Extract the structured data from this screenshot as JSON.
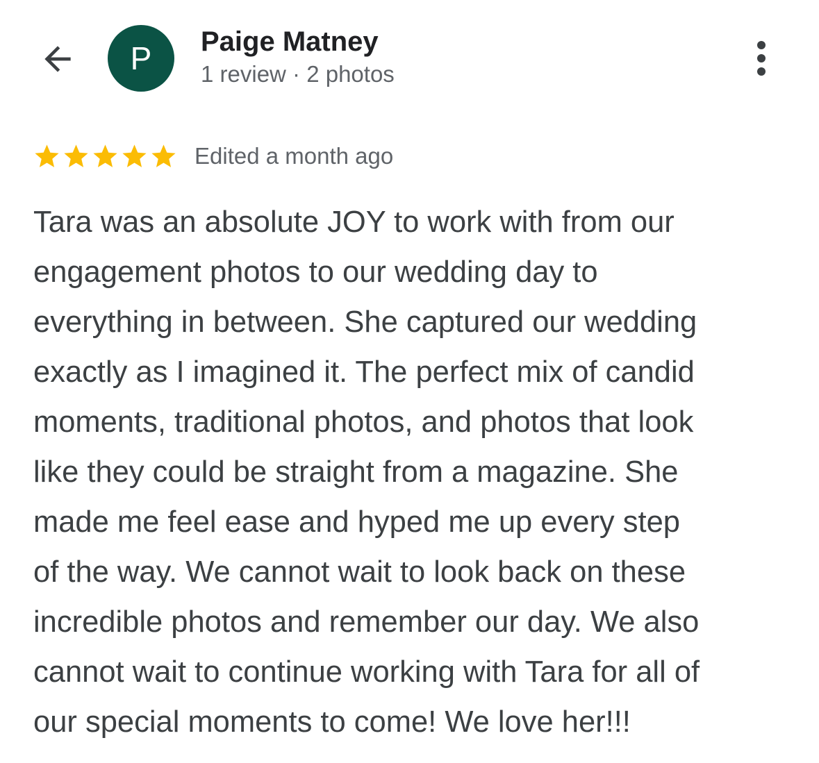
{
  "header": {
    "back_icon": "arrow-left-icon",
    "avatar_letter": "P",
    "avatar_color": "#0b5345",
    "reviewer_name": "Paige Matney",
    "reviewer_meta": "1 review · 2 photos",
    "more_icon": "more-vert-icon"
  },
  "review": {
    "rating": 5,
    "rating_max": 5,
    "star_color": "#fbbc04",
    "edited_label": "Edited a month ago",
    "text_lines": [
      "Tara was an absolute JOY to work with from our",
      "engagement photos to our wedding day to",
      "everything in between. She captured our wedding",
      "exactly as I imagined it. The perfect mix of candid",
      "moments, traditional photos, and photos that look",
      "like they could be straight from a magazine. She",
      "made me feel ease and hyped me up every step",
      "of the way. We cannot wait to look back on these",
      "incredible photos and remember our day. We also",
      "cannot wait to continue working with Tara for all of",
      "our special moments to come! We love her!!!"
    ]
  }
}
